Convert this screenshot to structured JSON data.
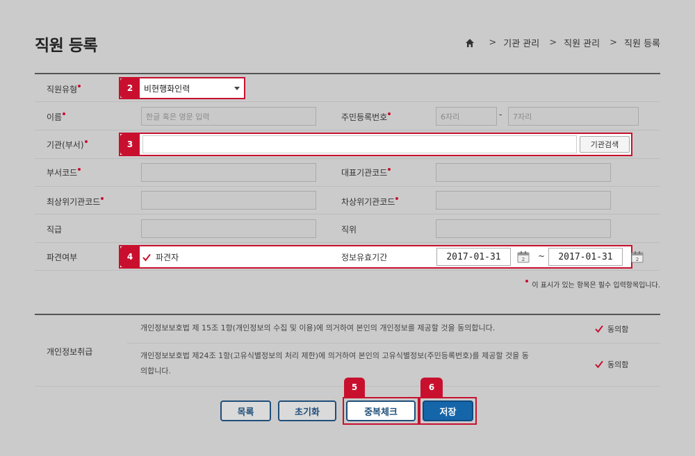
{
  "page": {
    "title": "직원 등록",
    "breadcrumb": [
      "기관 관리",
      "직원 관리",
      "직원 등록"
    ],
    "breadcrumb_sep": ">"
  },
  "form": {
    "employee_type": {
      "label": "직원유형",
      "value": "비현행화인력",
      "badge": "2"
    },
    "name": {
      "label": "이름",
      "placeholder": "한글 혹은 영문 입력"
    },
    "resident_no": {
      "label": "주민등록번호",
      "placeholder1": "6자리",
      "placeholder2": "7자리",
      "dash": "-"
    },
    "org": {
      "label": "기관(부서)",
      "badge": "3",
      "search_label": "기관검색"
    },
    "dept_code": {
      "label": "부서코드"
    },
    "rep_org_code": {
      "label": "대표기관코드"
    },
    "top_org_code": {
      "label": "최상위기관코드"
    },
    "sub_top_org_code": {
      "label": "차상위기관코드"
    },
    "rank": {
      "label": "직급"
    },
    "position": {
      "label": "직위"
    },
    "dispatch": {
      "label": "파견여부",
      "badge": "4",
      "checkbox_label": "파견자"
    },
    "validity": {
      "label": "정보유효기간",
      "start": "2017-01-31",
      "end": "2017-01-31",
      "tilde": "~"
    },
    "required_note": "이 표시가 있는 항목은 필수 입력항목입니다."
  },
  "privacy": {
    "label": "개인정보취급",
    "items": [
      {
        "text": "개인정보보호법 제 15조 1항(개인정보의 수집 및 이용)에 의거하여 본인의 개인정보를 제공할 것을 동의합니다.",
        "agree": "동의함"
      },
      {
        "text1": "개인정보보호법 제24조 1항(고유식별정보의 처리 제한)에 의거하여 본인의 고유식별정보(주민등록번호)를 제공할 것을 동",
        "text2": "의합니다.",
        "agree": "동의함"
      }
    ]
  },
  "buttons": {
    "list": "목록",
    "reset": "초기화",
    "dup_check": "중복체크",
    "dup_badge": "5",
    "save": "저장",
    "save_badge": "6"
  },
  "colors": {
    "highlight": "#c8102e",
    "primary": "#1565a9",
    "navy": "#1f4e79"
  }
}
